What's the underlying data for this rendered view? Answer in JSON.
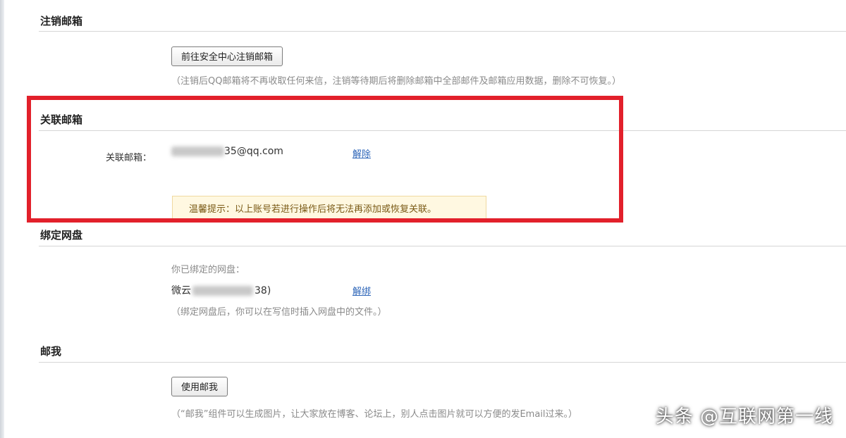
{
  "sections": {
    "cancel_mailbox": {
      "title": "注销邮箱",
      "button_label": "前往安全中心注销邮箱",
      "note": "（注销后QQ邮箱将不再收取任何来信，注销等待期后将删除邮箱中全部邮件及邮箱应用数据，删除不可恢复。）"
    },
    "linked_mailbox": {
      "title": "关联邮箱",
      "field_label": "关联邮箱：",
      "email_visible_suffix": "35@qq.com",
      "unlink_label": "解除",
      "warning": "温馨提示：以上账号若进行操作后将无法再添加或恢复关联。"
    },
    "bind_netdisk": {
      "title": "绑定网盘",
      "bound_label": "你已绑定的网盘：",
      "netdisk_prefix": "微云",
      "netdisk_suffix": "38)",
      "unbind_label": "解绑",
      "note": "（绑定网盘后，你可以在写信时插入网盘中的文件。）"
    },
    "mail_me": {
      "title": "邮我",
      "button_label": "使用邮我",
      "note": "（“邮我”组件可以生成图片，让大家放在博客、论坛上，别人点击图片就可以方便的发Email过来。）"
    }
  },
  "watermark": "头条 @互联网第一线",
  "colors": {
    "highlight_frame": "#e2202b",
    "link": "#2d65b8",
    "warning_bg": "#fff8e1"
  }
}
